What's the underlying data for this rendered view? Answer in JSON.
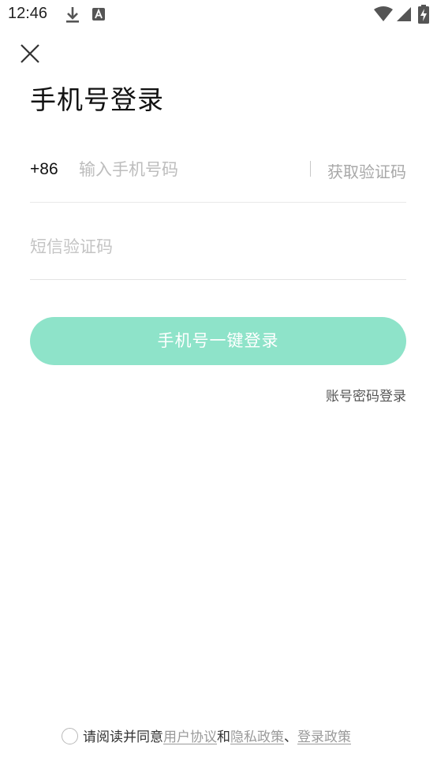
{
  "status_bar": {
    "time": "12:46",
    "icons": [
      "download-icon",
      "text-a-icon",
      "wifi-icon",
      "cellular-signal-icon",
      "battery-charging-icon"
    ]
  },
  "header": {
    "close_icon": "close-icon",
    "title": "手机号登录"
  },
  "phone": {
    "country_code": "+86",
    "placeholder": "输入手机号码",
    "value": "",
    "get_code_label": "获取验证码"
  },
  "sms": {
    "placeholder": "短信验证码",
    "value": ""
  },
  "actions": {
    "login_label": "手机号一键登录",
    "login_color": "#8ee3c9",
    "account_login_label": "账号密码登录"
  },
  "agreement": {
    "checked": false,
    "prefix": "请阅读并同意",
    "user_agreement": "用户协议",
    "conjunction": "和",
    "privacy_policy": "隐私政策",
    "separator": "、",
    "login_policy": "登录政策"
  }
}
